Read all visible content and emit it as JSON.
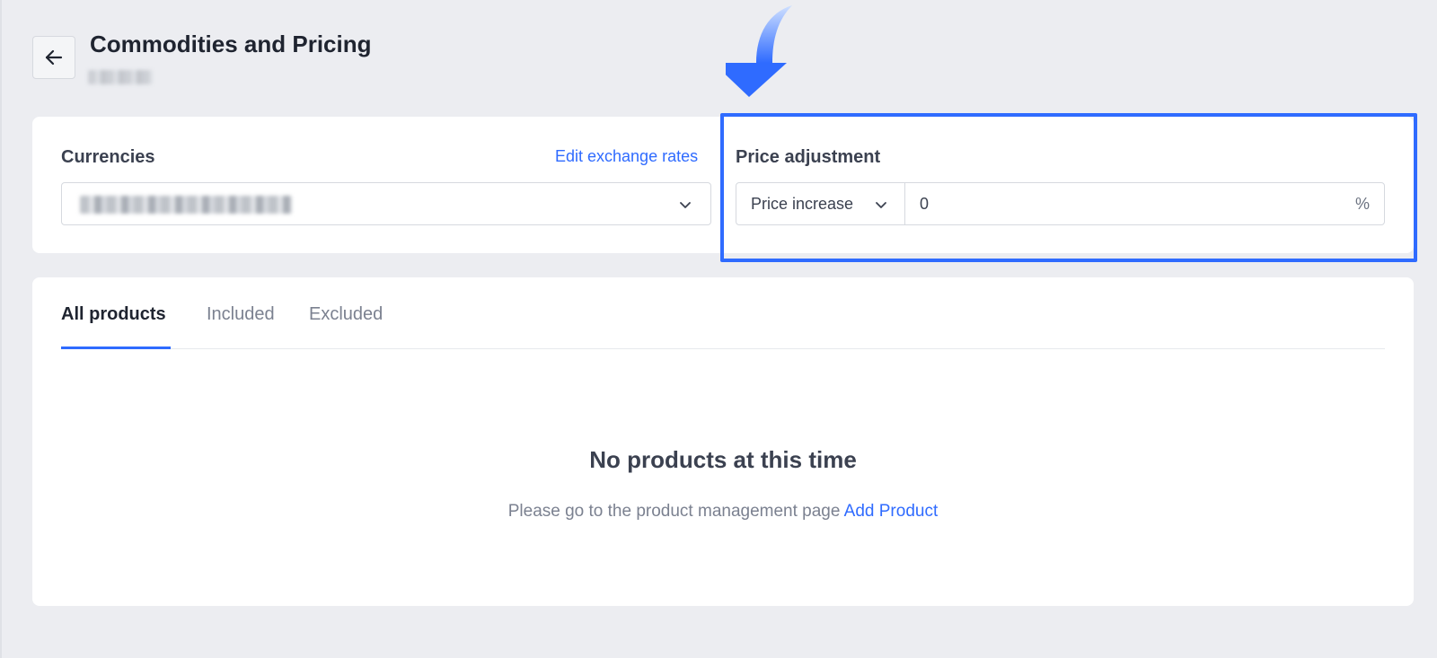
{
  "header": {
    "title": "Commodities and Pricing"
  },
  "currencies": {
    "label": "Currencies",
    "edit_link": "Edit exchange rates"
  },
  "price_adjustment": {
    "label": "Price adjustment",
    "mode": "Price increase",
    "value": "0",
    "unit": "%"
  },
  "tabs": [
    {
      "label": "All products",
      "active": true
    },
    {
      "label": "Included",
      "active": false
    },
    {
      "label": "Excluded",
      "active": false
    }
  ],
  "empty_state": {
    "title": "No products at this time",
    "text": "Please go to the product management page ",
    "link": "Add Product"
  },
  "colors": {
    "accent": "#2f6bff",
    "background": "#ecedf1"
  }
}
